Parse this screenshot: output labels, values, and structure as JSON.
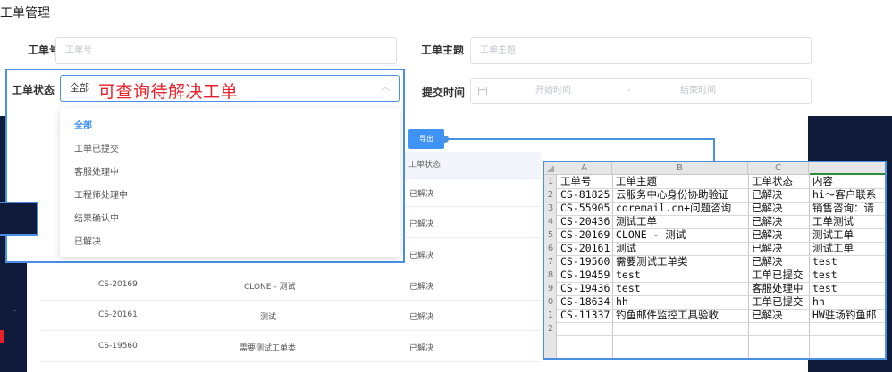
{
  "page_title": "工单管理",
  "form": {
    "ticket_no_label": "工单号",
    "ticket_no_placeholder": "工单号",
    "subject_label": "工单主题",
    "subject_placeholder": "工单主题",
    "status_label": "工单状态",
    "status_value": "全部",
    "submit_time_label": "提交时间",
    "start_placeholder": "开始时间",
    "separator": "-",
    "end_placeholder": "结束时间"
  },
  "annotation": "可查询待解决工单",
  "status_dropdown": {
    "options": [
      "全部",
      "工单已提交",
      "客服处理中",
      "工程师处理中",
      "结果确认中",
      "已解决"
    ],
    "selected": "全部"
  },
  "export_label": "导出",
  "table": {
    "status_header": "工单状态",
    "rows": [
      {
        "status": "已解决"
      },
      {
        "status": "已解决"
      },
      {
        "status": "已解决"
      },
      {
        "id": "CS-20169",
        "subject": "CLONE - 测试",
        "status": "已解决"
      },
      {
        "id": "CS-20161",
        "subject": "测试",
        "status": "已解决"
      },
      {
        "id": "CS-19560",
        "subject": "需要测试工单类",
        "status": "已解决"
      }
    ]
  },
  "spreadsheet": {
    "columns": [
      "A",
      "B",
      "C"
    ],
    "row_numbers": [
      "1",
      "2",
      "3",
      "4",
      "5",
      "6",
      "7",
      "8",
      "9",
      "0",
      "1",
      "2"
    ],
    "rows": [
      [
        "工单号",
        "工单主题",
        "工单状态",
        "内容"
      ],
      [
        "CS-81825",
        "云服务中心身份协助验证",
        "已解决",
        "hi～客户联系"
      ],
      [
        "CS-55905",
        "coremail.cn+问题咨询",
        "已解决",
        "销售咨询：请"
      ],
      [
        "CS-20436",
        "测试工单",
        "已解决",
        "工单测试"
      ],
      [
        "CS-20169",
        "CLONE - 测试",
        "已解决",
        "测试工单"
      ],
      [
        "CS-20161",
        "测试",
        "已解决",
        "测试工单"
      ],
      [
        "CS-19560",
        "需要测试工单类",
        "已解决",
        "test"
      ],
      [
        "CS-19459",
        "test",
        "工单已提交",
        "test"
      ],
      [
        "CS-19436",
        "test",
        "客服处理中",
        "test"
      ],
      [
        "CS-18634",
        "hh",
        "工单已提交",
        "hh"
      ],
      [
        "CS-11337",
        "钓鱼邮件监控工具验收",
        "已解决",
        "HW驻场钓鱼邮"
      ]
    ]
  }
}
